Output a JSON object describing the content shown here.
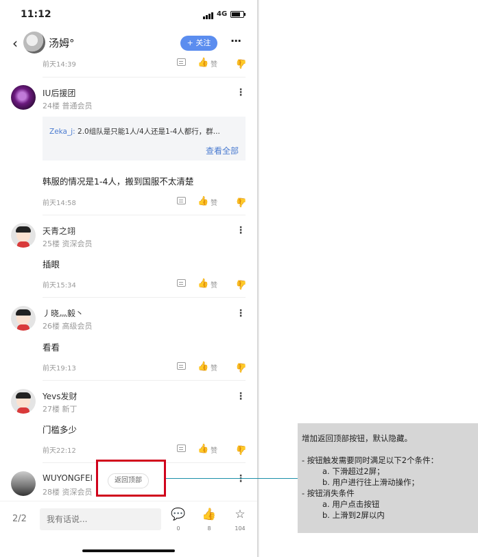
{
  "status_bar": {
    "time": "11:12",
    "network": "4G"
  },
  "header": {
    "back": "‹",
    "username": "汤姆°",
    "follow_label": "+ 关注",
    "more": "···"
  },
  "top_actions": {
    "time": "前天14:39",
    "like": "赞"
  },
  "posts": [
    {
      "name": "IU后援团",
      "meta": "24楼  普通会员",
      "quote_name": "Zeka_j:",
      "quote_text": " 2.0组队是只能1人/4人还是1-4人都行，群...",
      "quote_more": "查看全部",
      "body": "韩服的情况是1-4人，搬到国服不太清楚",
      "time": "前天14:58",
      "like": "赞"
    },
    {
      "name": "天青之翊",
      "meta": "25楼  资深会员",
      "body": "插眼",
      "time": "前天15:34",
      "like": "赞"
    },
    {
      "name": "丿晓灬毅丶",
      "meta": "26楼  高级会员",
      "body": "看看",
      "time": "前天19:13",
      "like": "赞"
    },
    {
      "name": "Yevs发财",
      "meta": "27楼  新丁",
      "body": "门槛多少",
      "time": "前天22:12",
      "like": "赞"
    },
    {
      "name": "WUYONGFEI",
      "meta": "28楼  资深会员"
    }
  ],
  "back_to_top_label": "返回顶部",
  "bottom_bar": {
    "pager": "2/2",
    "input_placeholder": "我有话说...",
    "comment_count": "0",
    "like_count": "8",
    "fav_count": "104"
  },
  "annotation": {
    "line1": "增加返回顶部按钮，默认隐藏。",
    "line2": "- 按钮触发需要同时满足以下2个条件：",
    "line3": "a. 下滑超过2屏；",
    "line4": "b. 用户进行往上滑动操作；",
    "line5": "- 按钮消失条件",
    "line6": "a. 用户点击按钮",
    "line7": "b. 上滑到2屏以内"
  },
  "colors": {
    "follow": "#5b8def",
    "highlight_box": "#d0021b",
    "connector": "#1a8fa8",
    "link": "#4a7bd0"
  }
}
